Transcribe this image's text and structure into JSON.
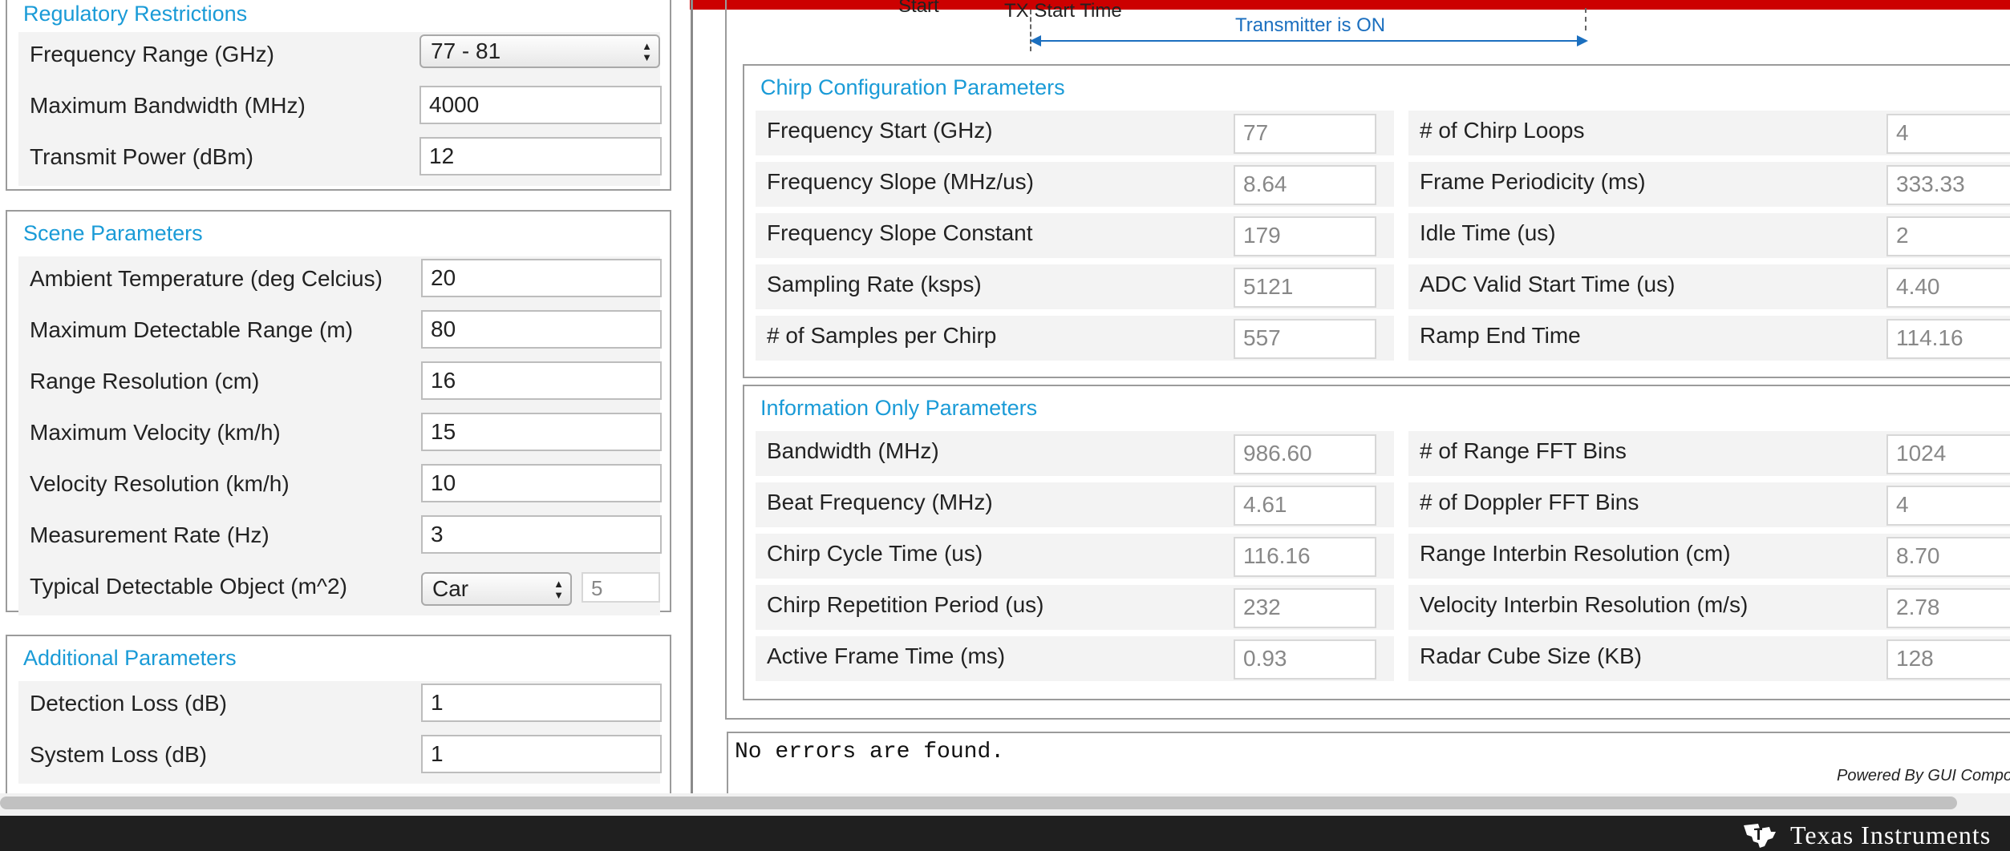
{
  "regulatory": {
    "title": "Regulatory Restrictions",
    "frequency_range_label": "Frequency Range (GHz)",
    "frequency_range_value": "77 - 81",
    "max_bandwidth_label": "Maximum Bandwidth (MHz)",
    "max_bandwidth_value": "4000",
    "transmit_power_label": "Transmit Power (dBm)",
    "transmit_power_value": "12"
  },
  "scene": {
    "title": "Scene Parameters",
    "rows": [
      {
        "label": "Ambient Temperature (deg Celcius)",
        "value": "20"
      },
      {
        "label": "Maximum Detectable Range (m)",
        "value": "80"
      },
      {
        "label": "Range Resolution (cm)",
        "value": "16"
      },
      {
        "label": "Maximum Velocity (km/h)",
        "value": "15"
      },
      {
        "label": "Velocity Resolution (km/h)",
        "value": "10"
      },
      {
        "label": "Measurement Rate (Hz)",
        "value": "3"
      }
    ],
    "object_label": "Typical Detectable Object (m^2)",
    "object_select": "Car",
    "object_value": "5"
  },
  "additional": {
    "title": "Additional Parameters",
    "rows": [
      {
        "label": "Detection Loss (dB)",
        "value": "1"
      },
      {
        "label": "System Loss (dB)",
        "value": "1"
      }
    ]
  },
  "timing": {
    "start_label": "Start",
    "tx_start_label": "TX Start Time",
    "transmitter_label": "Transmitter is ON"
  },
  "chirp": {
    "title": "Chirp Configuration Parameters",
    "left": [
      {
        "label": "Frequency Start (GHz)",
        "value": "77"
      },
      {
        "label": "Frequency Slope (MHz/us)",
        "value": "8.64"
      },
      {
        "label": "Frequency Slope Constant",
        "value": "179"
      },
      {
        "label": "Sampling Rate (ksps)",
        "value": "5121"
      },
      {
        "label": "# of Samples per Chirp",
        "value": "557"
      }
    ],
    "right": [
      {
        "label": "# of Chirp Loops",
        "value": "4"
      },
      {
        "label": "Frame Periodicity (ms)",
        "value": "333.33"
      },
      {
        "label": "Idle Time (us)",
        "value": "2"
      },
      {
        "label": "ADC Valid Start Time (us)",
        "value": "4.40"
      },
      {
        "label": "Ramp End Time",
        "value": "114.16"
      }
    ]
  },
  "info": {
    "title": "Information Only Parameters",
    "left": [
      {
        "label": "Bandwidth (MHz)",
        "value": "986.60"
      },
      {
        "label": "Beat Frequency (MHz)",
        "value": "4.61"
      },
      {
        "label": "Chirp Cycle Time (us)",
        "value": "116.16"
      },
      {
        "label": "Chirp Repetition Period (us)",
        "value": "232"
      },
      {
        "label": "Active Frame Time (ms)",
        "value": "0.93"
      }
    ],
    "right": [
      {
        "label": "# of Range FFT Bins",
        "value": "1024"
      },
      {
        "label": "# of Doppler FFT Bins",
        "value": "4"
      },
      {
        "label": "Range Interbin Resolution (cm)",
        "value": "8.70"
      },
      {
        "label": "Velocity Interbin Resolution (m/s)",
        "value": "2.78"
      },
      {
        "label": "Radar Cube Size (KB)",
        "value": "128"
      }
    ]
  },
  "status": {
    "message": "No errors are found.",
    "powered_by": "Powered By GUI Composer ™"
  },
  "footer": {
    "brand": "Texas Instruments",
    "logo_icon": "ti-logo-icon"
  },
  "colors": {
    "accent": "#1a9bd7",
    "top_bar": "#cc0000",
    "footer_bg": "#1f1f1f",
    "arrow": "#1b6fbf"
  }
}
